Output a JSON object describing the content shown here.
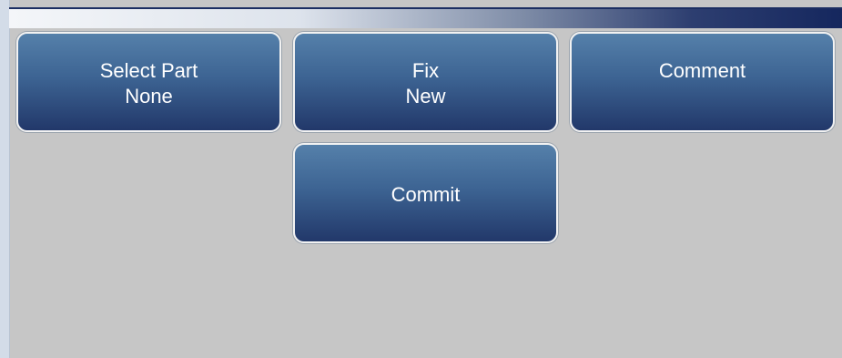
{
  "buttons": {
    "select_part": {
      "label": "Select Part",
      "value": "None"
    },
    "fix": {
      "label": "Fix",
      "value": "New"
    },
    "comment": {
      "label": "Comment"
    },
    "commit": {
      "label": "Commit"
    }
  },
  "colors": {
    "background": "#c6c6c6",
    "button_top": "#5580aa",
    "button_bottom": "#22386a",
    "button_border": "#f2f2f2",
    "title_bar_dark": "#15275e",
    "title_bar_light": "#f4f6f9"
  }
}
